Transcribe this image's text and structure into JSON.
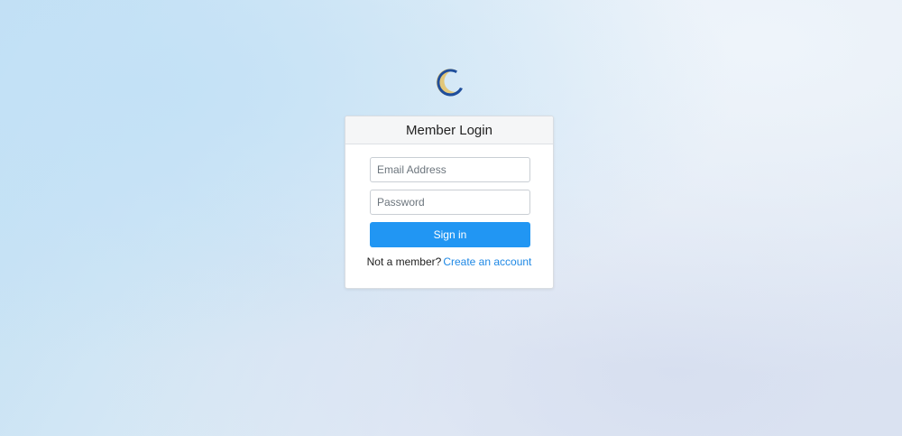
{
  "logo": {
    "icon": "crescent-logo-icon",
    "colors": {
      "outer": "#1f4e9c",
      "inner": "#e2c77a"
    }
  },
  "login": {
    "title": "Member Login",
    "email_placeholder": "Email Address",
    "password_placeholder": "Password",
    "signin_label": "Sign in",
    "prompt_text": "Not a member?",
    "create_account_link": "Create an account"
  },
  "colors": {
    "primary": "#2196f3",
    "link": "#1e88e5"
  }
}
